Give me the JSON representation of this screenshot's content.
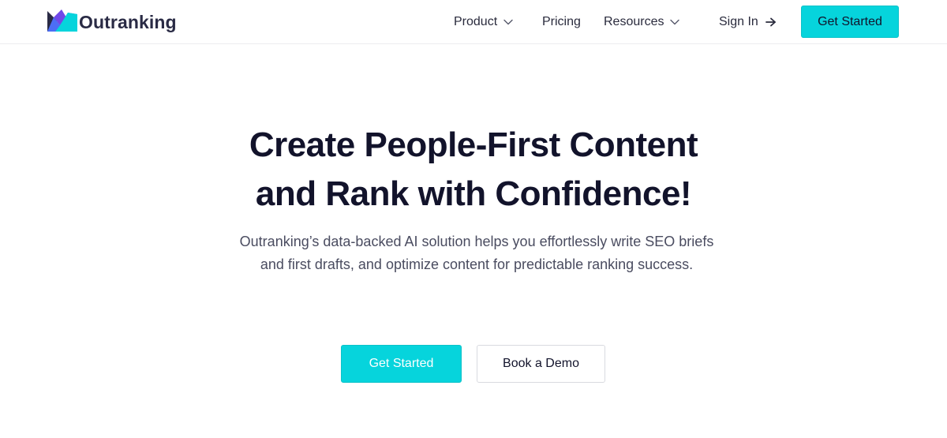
{
  "brand": {
    "name": "Outranking"
  },
  "nav": {
    "product": "Product",
    "pricing": "Pricing",
    "resources": "Resources",
    "sign_in": "Sign In",
    "get_started": "Get Started"
  },
  "hero": {
    "title_line1": "Create People-First Content",
    "title_line2": "and Rank with Confidence!",
    "subtitle": "Outranking’s data-backed AI solution helps you effortlessly write SEO briefs and first drafts, and optimize content for predictable ranking success.",
    "primary_cta": "Get Started",
    "secondary_cta": "Book a Demo"
  },
  "colors": {
    "accent": "#06d4dc",
    "heading": "#12132b",
    "body_text": "#4a4c60",
    "logo_navy": "#2a2b45",
    "logo_blue": "#3b5bdb",
    "logo_purple": "#7048e8"
  },
  "icons": {
    "logo": "outranking-logo-icon",
    "product_caret": "chevron-down-icon",
    "resources_caret": "chevron-down-icon",
    "sign_in_arrow": "arrow-right-icon"
  }
}
